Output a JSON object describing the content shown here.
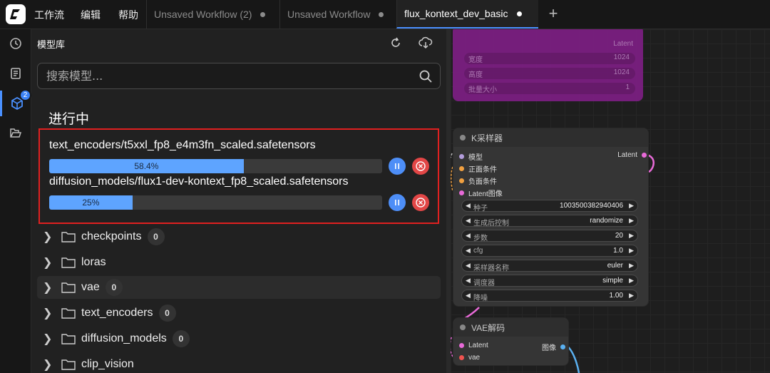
{
  "topbar": {
    "menu": [
      "工作流",
      "编辑",
      "帮助"
    ],
    "tabs": [
      {
        "label": "Unsaved Workflow (2)"
      },
      {
        "label": "Unsaved Workflow"
      },
      {
        "label": "flux_kontext_dev_basic"
      }
    ],
    "active_tab": 2,
    "new_tab_label": "+"
  },
  "rail": {
    "icons": [
      "history-icon",
      "queue-icon",
      "model-library-icon",
      "workflows-icon"
    ],
    "badge": "2"
  },
  "panel": {
    "title": "模型库",
    "search_placeholder": "搜索模型...",
    "section_title": "进行中",
    "downloads": [
      {
        "name": "text_encoders/t5xxl_fp8_e4m3fn_scaled.safetensors",
        "progress": 0.584,
        "progress_label": "58.4%"
      },
      {
        "name": "diffusion_models/flux1-dev-kontext_fp8_scaled.safetensors",
        "progress": 0.25,
        "progress_label": "25%"
      }
    ],
    "folders": [
      {
        "name": "checkpoints",
        "count": "0"
      },
      {
        "name": "loras",
        "count": ""
      },
      {
        "name": "vae",
        "count": "0"
      },
      {
        "name": "text_encoders",
        "count": "0"
      },
      {
        "name": "diffusion_models",
        "count": "0"
      },
      {
        "name": "clip_vision",
        "count": ""
      }
    ]
  },
  "canvas": {
    "purple_node": {
      "output": "Latent",
      "rows": [
        {
          "label": "宽度",
          "value": "1024"
        },
        {
          "label": "高度",
          "value": "1024"
        },
        {
          "label": "批量大小",
          "value": "1"
        }
      ]
    },
    "ksampler": {
      "title": "K采样器",
      "inputs": [
        "模型",
        "正面条件",
        "负面条件",
        "Latent图像"
      ],
      "output": "Latent",
      "widgets": [
        {
          "label": "种子",
          "value": "1003500382940406"
        },
        {
          "label": "生成后控制",
          "value": "randomize"
        },
        {
          "label": "步数",
          "value": "20"
        },
        {
          "label": "cfg",
          "value": "1.0"
        },
        {
          "label": "采样器名称",
          "value": "euler"
        },
        {
          "label": "调度器",
          "value": "simple"
        },
        {
          "label": "降噪",
          "value": "1.00"
        }
      ]
    },
    "vae_decode": {
      "title": "VAE解码",
      "inputs": [
        "Latent",
        "vae"
      ],
      "output": "图像"
    }
  },
  "colors": {
    "accent": "#4a90ff",
    "progress_fill": "#5ea4ff",
    "highlight_border": "#e02020",
    "cancel": "#e24646",
    "purple_node": "#7a1f80"
  }
}
